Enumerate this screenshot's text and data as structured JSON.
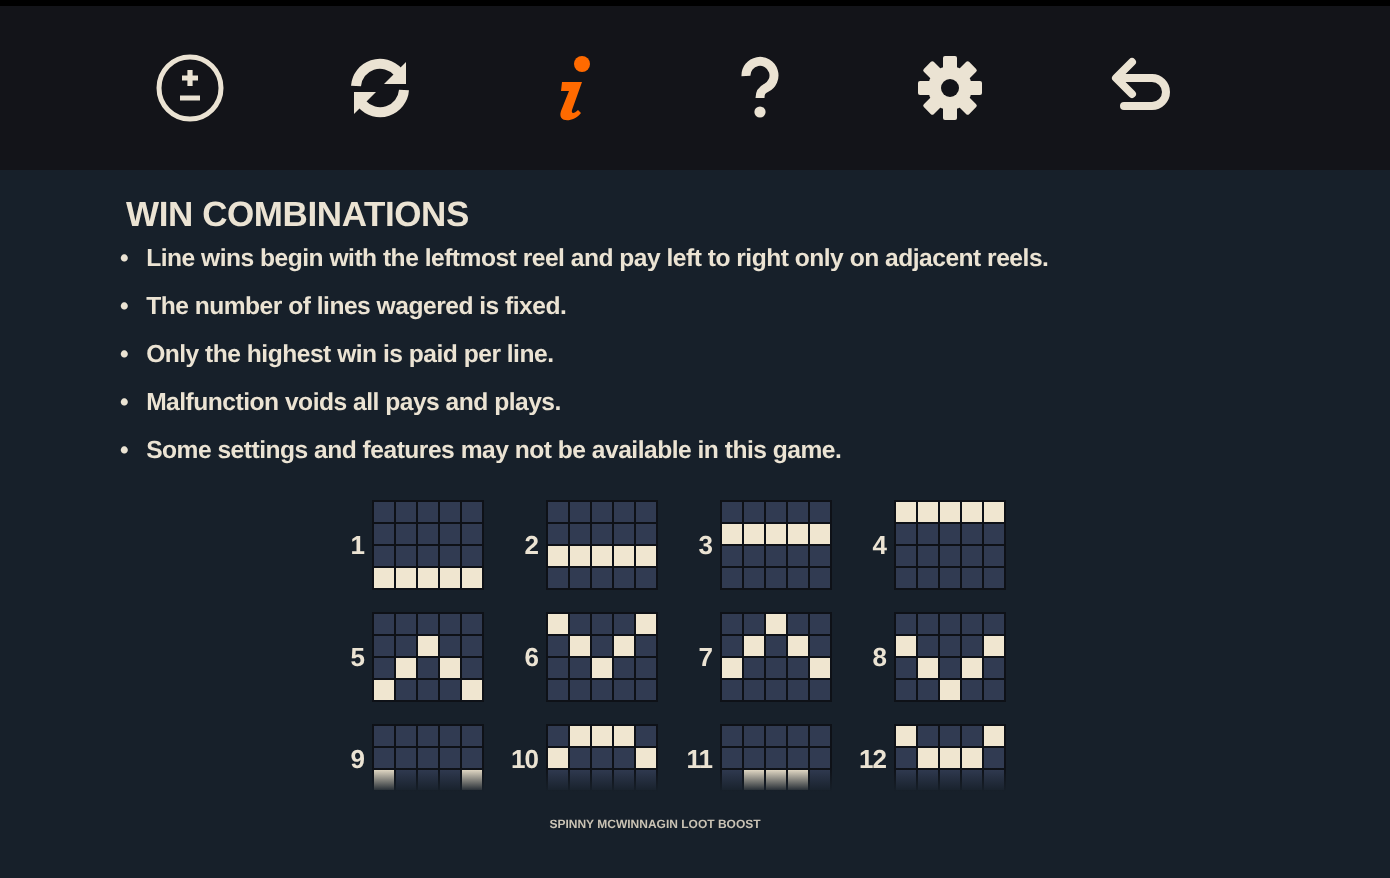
{
  "toolbar": [
    {
      "kind": "bet",
      "selected": false
    },
    {
      "kind": "autoplay",
      "selected": false
    },
    {
      "kind": "info",
      "selected": true
    },
    {
      "kind": "help",
      "selected": false
    },
    {
      "kind": "settings",
      "selected": false
    },
    {
      "kind": "back",
      "selected": false
    }
  ],
  "title": "WIN COMBINATIONS",
  "bullet": "•",
  "rules": [
    "Line wins begin with the leftmost reel and pay left to right only on adjacent reels.",
    "The number of lines wagered is fixed.",
    "Only the highest win is paid per line.",
    "Malfunction voids all pays and plays.",
    "Some settings and features may not be available in this game."
  ],
  "paylines": [
    {
      "number": "1",
      "cells": [
        [
          false,
          false,
          false,
          false,
          false
        ],
        [
          false,
          false,
          false,
          false,
          false
        ],
        [
          false,
          false,
          false,
          false,
          false
        ],
        [
          true,
          true,
          true,
          true,
          true
        ]
      ],
      "faded": false
    },
    {
      "number": "2",
      "cells": [
        [
          false,
          false,
          false,
          false,
          false
        ],
        [
          false,
          false,
          false,
          false,
          false
        ],
        [
          true,
          true,
          true,
          true,
          true
        ],
        [
          false,
          false,
          false,
          false,
          false
        ]
      ],
      "faded": false
    },
    {
      "number": "3",
      "cells": [
        [
          false,
          false,
          false,
          false,
          false
        ],
        [
          true,
          true,
          true,
          true,
          true
        ],
        [
          false,
          false,
          false,
          false,
          false
        ],
        [
          false,
          false,
          false,
          false,
          false
        ]
      ],
      "faded": false
    },
    {
      "number": "4",
      "cells": [
        [
          true,
          true,
          true,
          true,
          true
        ],
        [
          false,
          false,
          false,
          false,
          false
        ],
        [
          false,
          false,
          false,
          false,
          false
        ],
        [
          false,
          false,
          false,
          false,
          false
        ]
      ],
      "faded": false
    },
    {
      "number": "5",
      "cells": [
        [
          false,
          false,
          false,
          false,
          false
        ],
        [
          false,
          false,
          true,
          false,
          false
        ],
        [
          false,
          true,
          false,
          true,
          false
        ],
        [
          true,
          false,
          false,
          false,
          true
        ]
      ],
      "faded": false
    },
    {
      "number": "6",
      "cells": [
        [
          true,
          false,
          false,
          false,
          true
        ],
        [
          false,
          true,
          false,
          true,
          false
        ],
        [
          false,
          false,
          true,
          false,
          false
        ],
        [
          false,
          false,
          false,
          false,
          false
        ]
      ],
      "faded": false
    },
    {
      "number": "7",
      "cells": [
        [
          false,
          false,
          true,
          false,
          false
        ],
        [
          false,
          true,
          false,
          true,
          false
        ],
        [
          true,
          false,
          false,
          false,
          true
        ],
        [
          false,
          false,
          false,
          false,
          false
        ]
      ],
      "faded": false
    },
    {
      "number": "8",
      "cells": [
        [
          false,
          false,
          false,
          false,
          false
        ],
        [
          true,
          false,
          false,
          false,
          true
        ],
        [
          false,
          true,
          false,
          true,
          false
        ],
        [
          false,
          false,
          true,
          false,
          false
        ]
      ],
      "faded": false
    },
    {
      "number": "9",
      "cells": [
        [
          false,
          false,
          false,
          false,
          false
        ],
        [
          false,
          false,
          false,
          false,
          false
        ],
        [
          true,
          false,
          false,
          false,
          true
        ]
      ],
      "faded": true
    },
    {
      "number": "10",
      "cells": [
        [
          false,
          true,
          true,
          true,
          false
        ],
        [
          true,
          false,
          false,
          false,
          true
        ],
        [
          false,
          false,
          false,
          false,
          false
        ]
      ],
      "faded": true
    },
    {
      "number": "11",
      "cells": [
        [
          false,
          false,
          false,
          false,
          false
        ],
        [
          false,
          false,
          false,
          false,
          false
        ],
        [
          false,
          true,
          true,
          true,
          false
        ]
      ],
      "faded": true
    },
    {
      "number": "12",
      "cells": [
        [
          true,
          false,
          false,
          false,
          true
        ],
        [
          false,
          true,
          true,
          true,
          false
        ],
        [
          false,
          false,
          false,
          false,
          false
        ]
      ],
      "faded": true
    }
  ],
  "footer": "SPINNY MCWINNAGIN LOOT BOOST"
}
